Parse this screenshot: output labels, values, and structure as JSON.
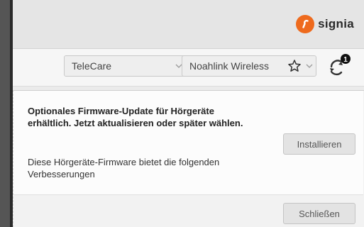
{
  "brand": {
    "name": "signia",
    "accent": "#ee6a1d"
  },
  "toolbar": {
    "telecare_select": "TeleCare",
    "noahlink_select": "Noahlink Wireless",
    "sync_badge": "1"
  },
  "dialog": {
    "title": "Optionales Firmware-Update für Hörgeräte erhältlich. Jetzt aktualisieren oder später wählen.",
    "description": "Diese Hörgeräte-Firmware bietet die folgenden Verbesserungen",
    "install_label": "Installieren",
    "close_label": "Schließen"
  },
  "icons": [
    "signia-logo-icon",
    "chevron-down-icon",
    "star-icon",
    "sync-icon"
  ]
}
